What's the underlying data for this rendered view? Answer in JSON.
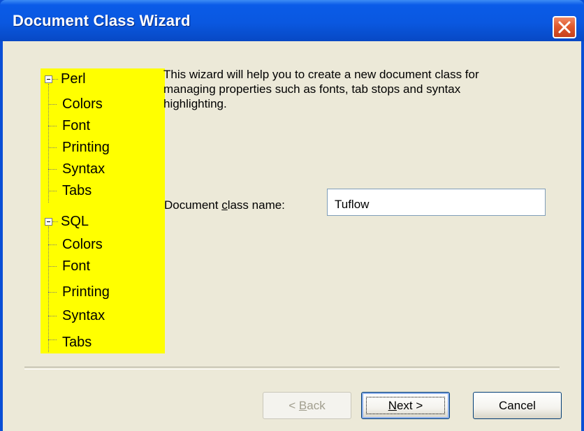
{
  "window": {
    "title": "Document Class Wizard",
    "close_icon": "close-icon"
  },
  "tree": {
    "background": "#ffff00",
    "groups": [
      {
        "label": "Perl",
        "expanded": true,
        "children": [
          "Colors",
          "Font",
          "Printing",
          "Syntax",
          "Tabs"
        ]
      },
      {
        "label": "SQL",
        "expanded": true,
        "children": [
          "Colors",
          "Font",
          "Printing",
          "Syntax",
          "Tabs"
        ]
      }
    ]
  },
  "main": {
    "intro": "This wizard will help you to create a new document class for managing properties such as fonts, tab stops and syntax highlighting.",
    "class_name": {
      "label_pre": "Document ",
      "label_accel": "c",
      "label_post": "lass name:",
      "value": "Tuflow"
    }
  },
  "buttons": {
    "back": {
      "pre": "< ",
      "accel": "B",
      "post": "ack",
      "enabled": false
    },
    "next": {
      "pre": "",
      "accel": "N",
      "post": "ext >",
      "enabled": true
    },
    "cancel": {
      "label": "Cancel",
      "enabled": true
    }
  },
  "colors": {
    "title_bar": "#0a58e0",
    "dialog_face": "#ece9d8",
    "close_button": "#e05a2e"
  }
}
